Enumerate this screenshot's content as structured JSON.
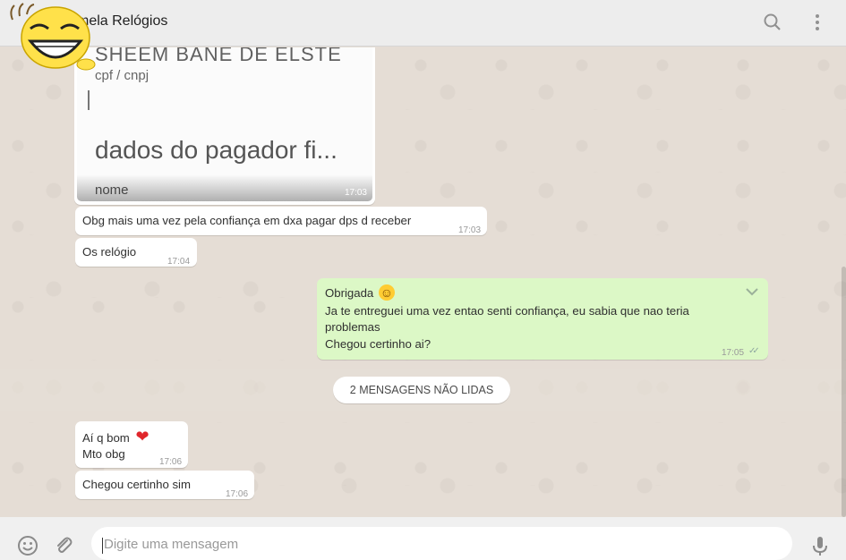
{
  "header": {
    "contact_name": "mela Relógios"
  },
  "messages": {
    "image": {
      "text_top": "SHEEM BANE DE ELSTE",
      "text_cpf": "cpf / cnpj",
      "text_dados": "dados do pagador fi...",
      "text_nome": "nome",
      "time": "17:03"
    },
    "m1": {
      "text": "Obg mais uma vez pela confiança em dxa pagar dps d receber",
      "time": "17:03"
    },
    "m2": {
      "text": "Os relógio",
      "time": "17:04"
    },
    "m3": {
      "line1": "Obrigada",
      "emoji": "☺",
      "line2": "Ja te entreguei uma vez entao senti confiança, eu sabia que nao teria",
      "line3": "problemas",
      "line4": "Chegou certinho ai?",
      "time": "17:05",
      "ticks": "✓✓"
    },
    "unread_label": "2 MENSAGENS NÃO LIDAS",
    "m4": {
      "line1": "Aí q bom",
      "emoji": "❤",
      "line2": "Mto obg",
      "time": "17:06"
    },
    "m5": {
      "text": "Chegou certinho sim",
      "time": "17:06"
    }
  },
  "footer": {
    "placeholder": "Digite uma mensagem"
  },
  "icons": [
    "search-icon",
    "menu-icon",
    "emoji-icon",
    "attach-icon",
    "mic-icon",
    "chevron-down-icon"
  ],
  "colors": {
    "outgoing": "#dcf8c6",
    "incoming": "#ffffff",
    "background": "#e5ddd5",
    "header": "#ededed"
  }
}
